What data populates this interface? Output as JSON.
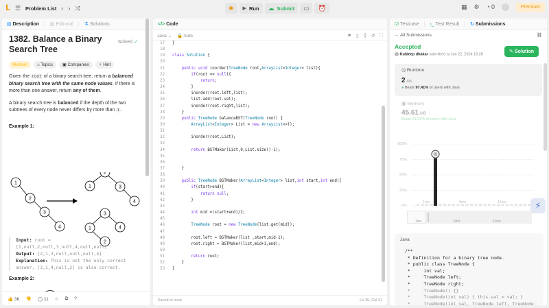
{
  "topbar": {
    "problem_list": "Problem List",
    "run": "Run",
    "submit": "Submit",
    "streak": "0",
    "premium": "Premium"
  },
  "desc": {
    "tabs": {
      "description": "Description",
      "editorial": "Editorial",
      "solutions": "Solutions"
    },
    "title": "1382. Balance a Binary Search Tree",
    "solved": "Solved",
    "tags": {
      "difficulty": "Medium",
      "topics": "Topics",
      "companies": "Companies",
      "hint": "Hint"
    },
    "p1": {
      "a": "Given the ",
      "code": "root",
      "b": " of a binary search tree, return ",
      "c": "a balanced binary search tree with the same node values",
      "d": ". If there is more than one answer, return ",
      "e": "any of them",
      "f": "."
    },
    "p2": {
      "a": "A binary search tree is ",
      "b": "balanced",
      "c": " if the depth of the two subtrees of every node never differs by more than ",
      "code": "1",
      "d": "."
    },
    "example1": "Example 1:",
    "tree_nodes": {
      "n1": "1",
      "n2": "2",
      "n3": "3",
      "n4": "4"
    },
    "input_label": "Input:",
    "input_value": "root = [1,null,2,null,3,null,4,null,null]",
    "output_label": "Output:",
    "output_value": "[2,1,3,null,null,null,4]",
    "explanation_label": "Explanation:",
    "explanation_value": "This is not the only correct answer, [3,1,4,null,2] is also correct.",
    "example2": "Example 2:",
    "likes": "3K",
    "comments": "11"
  },
  "editor": {
    "tab": "Code",
    "lang": "Java",
    "auto": "Auto",
    "lines": [
      {
        "n": "17",
        "t": "}"
      },
      {
        "n": "18",
        "t": ""
      },
      {
        "n": "19",
        "t": "class Solution {"
      },
      {
        "n": "20",
        "t": ""
      },
      {
        "n": "21",
        "t": "    public void inorder(TreeNode root,ArrayList<Integer> list){"
      },
      {
        "n": "22",
        "t": "        if(root == null){"
      },
      {
        "n": "23",
        "t": "            return;"
      },
      {
        "n": "24",
        "t": "        }"
      },
      {
        "n": "25",
        "t": "        inorder(root.left,list);"
      },
      {
        "n": "26",
        "t": "        list.add(root.val);"
      },
      {
        "n": "27",
        "t": "        inorder(root.right,list);"
      },
      {
        "n": "28",
        "t": "    }"
      },
      {
        "n": "29",
        "t": "    public TreeNode balanceBST(TreeNode root) {"
      },
      {
        "n": "30",
        "t": "        ArrayList<Integer> List = new ArrayList<>();"
      },
      {
        "n": "31",
        "t": ""
      },
      {
        "n": "32",
        "t": "        inorder(root,List);"
      },
      {
        "n": "33",
        "t": ""
      },
      {
        "n": "34",
        "t": "        return BSTMaker(List,0,List.size()-1);"
      },
      {
        "n": "35",
        "t": ""
      },
      {
        "n": "36",
        "t": ""
      },
      {
        "n": "37",
        "t": "    }"
      },
      {
        "n": "38",
        "t": ""
      },
      {
        "n": "39",
        "t": "    public TreeNode BSTMaker(ArrayList<Integer> list,int start,int end){"
      },
      {
        "n": "40",
        "t": "        if(start>end){"
      },
      {
        "n": "41",
        "t": "            return null;"
      },
      {
        "n": "42",
        "t": "        }"
      },
      {
        "n": "43",
        "t": ""
      },
      {
        "n": "44",
        "t": "        int mid =(start+end)/2;"
      },
      {
        "n": "45",
        "t": ""
      },
      {
        "n": "46",
        "t": "        TreeNode root = new TreeNode(list.get(mid));"
      },
      {
        "n": "47",
        "t": ""
      },
      {
        "n": "48",
        "t": "        root.left = BSTMaker(list ,start,mid-1);"
      },
      {
        "n": "49",
        "t": "        root.right = BSTMaker(list,mid+1,end);"
      },
      {
        "n": "50",
        "t": ""
      },
      {
        "n": "51",
        "t": "        return root;"
      },
      {
        "n": "52",
        "t": "    }"
      },
      {
        "n": "53",
        "t": "}"
      }
    ],
    "saved": "Saved to local",
    "cursor": "Ln 35, Col 31"
  },
  "submissions": {
    "tabs": {
      "testcase": "Testcase",
      "test_result": "Test Result",
      "submissions": "Submissions"
    },
    "back": "All Submissions",
    "status": "Accepted",
    "user": "Kuldeep dhakar",
    "submitted": "submitted at Jan 22, 2024 18:28",
    "solution_btn": "Solution",
    "runtime_label": "Runtime",
    "runtime_value": "2",
    "runtime_unit": "ms",
    "runtime_beats_a": "Beats ",
    "runtime_beats_b": "97.41%",
    "runtime_beats_c": " of users with Java",
    "memory_label": "Memory",
    "memory_value": "45.61",
    "memory_unit": "MB",
    "memory_beats": "Beats 51.52% of users with Java",
    "yticks": [
      "100%",
      "75%",
      "50%",
      "25%",
      "0%"
    ],
    "xticks": [
      "1ms",
      "6ms",
      "11ms"
    ],
    "mini_xticks": [
      "1ms",
      "6ms",
      "11ms"
    ],
    "lang": "Java",
    "code": [
      "/**",
      " * Definition for a binary tree node.",
      " * public class TreeNode {",
      " *     int val;",
      " *     TreeNode left;",
      " *     TreeNode right;",
      " *     TreeNode() {}",
      " *     TreeNode(int val) { this.val = val; }",
      " *     TreeNode(int val, TreeNode left, TreeNode"
    ]
  },
  "chart_data": {
    "type": "bar",
    "title": "",
    "xlabel": "",
    "ylabel": "",
    "x_ticks": [
      "1ms",
      "6ms",
      "11ms"
    ],
    "y_ticks": [
      "100%",
      "75%",
      "50%",
      "25%",
      "0%"
    ],
    "highlight": {
      "x": "2ms",
      "beats": "97.41%"
    }
  }
}
